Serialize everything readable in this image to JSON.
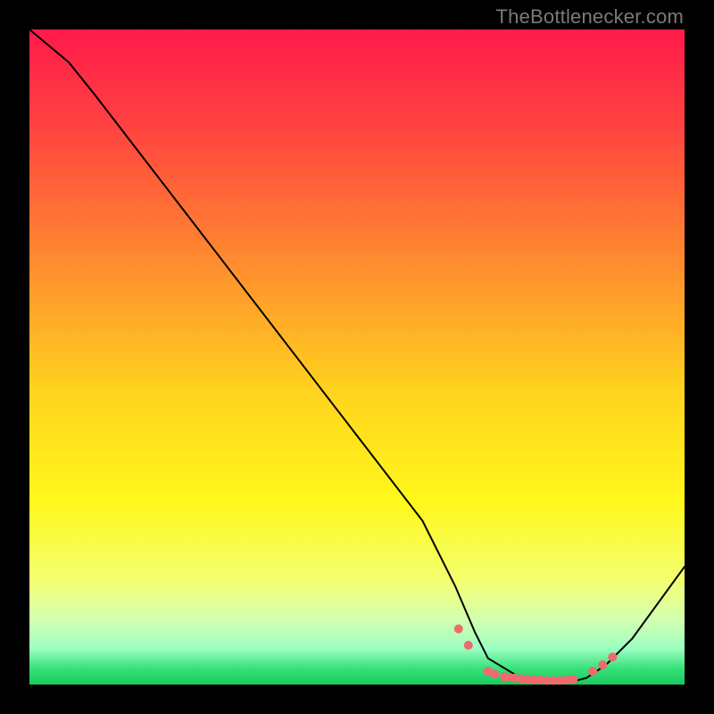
{
  "watermark": "TheBottlenecker.com",
  "chart_data": {
    "type": "line",
    "title": "",
    "xlabel": "",
    "ylabel": "",
    "xlim": [
      0,
      100
    ],
    "ylim": [
      0,
      100
    ],
    "background_gradient": [
      {
        "stop": 0.0,
        "color": "#ff1a4b"
      },
      {
        "stop": 0.15,
        "color": "#ff4340"
      },
      {
        "stop": 0.35,
        "color": "#ff8a2f"
      },
      {
        "stop": 0.55,
        "color": "#ffd21e"
      },
      {
        "stop": 0.72,
        "color": "#fff81a"
      },
      {
        "stop": 0.84,
        "color": "#f4ff70"
      },
      {
        "stop": 0.9,
        "color": "#d4ffb0"
      },
      {
        "stop": 0.945,
        "color": "#9cffc2"
      },
      {
        "stop": 0.975,
        "color": "#38e27a"
      },
      {
        "stop": 1.0,
        "color": "#18c85e"
      }
    ],
    "series": [
      {
        "name": "bottleneck-curve",
        "x": [
          0,
          6,
          10,
          20,
          30,
          40,
          50,
          60,
          65,
          68,
          70,
          75,
          80,
          83,
          85,
          88,
          92,
          100
        ],
        "y": [
          100,
          95,
          90,
          77,
          64,
          51,
          38,
          25,
          15,
          8,
          4,
          1,
          0.5,
          0.5,
          1,
          3,
          7,
          18
        ]
      }
    ],
    "markers": {
      "name": "optimal-range",
      "color": "#ef6a6d",
      "radius": 5,
      "x": [
        65.5,
        67,
        70,
        71,
        72.5,
        73,
        74,
        75,
        76,
        77,
        78,
        79,
        80,
        81,
        82,
        83,
        86,
        87.5,
        89
      ],
      "y": [
        8.5,
        6,
        2,
        1.6,
        1.2,
        1.1,
        1,
        0.9,
        0.8,
        0.7,
        0.7,
        0.6,
        0.6,
        0.6,
        0.7,
        0.8,
        2,
        3,
        4.2
      ]
    }
  }
}
